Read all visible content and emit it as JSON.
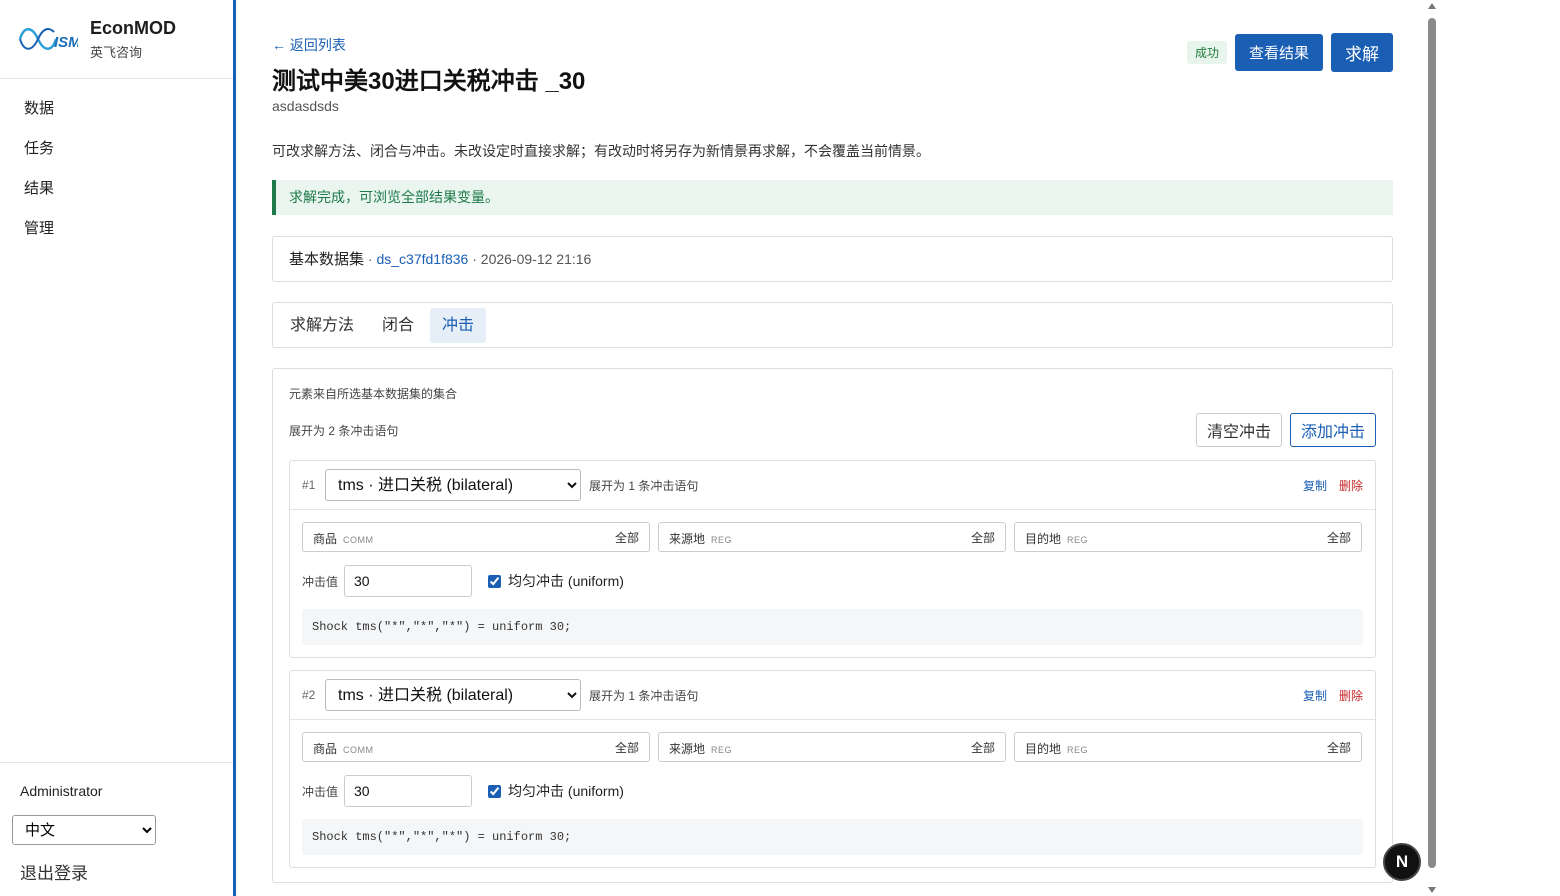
{
  "brand": {
    "name": "EconMOD",
    "sub": "英飞咨询",
    "logo_text": "ISM"
  },
  "sidebar": {
    "items": [
      {
        "label": "数据"
      },
      {
        "label": "任务"
      },
      {
        "label": "结果"
      },
      {
        "label": "管理"
      }
    ],
    "user": "Administrator",
    "language": "中文",
    "logout": "退出登录"
  },
  "header": {
    "back": "← 返回列表",
    "title": "测试中美30进口关税冲击 _30",
    "subtitle": "asdasdsds",
    "status_badge": "成功",
    "view_results": "查看结果",
    "solve": "求解"
  },
  "description": "可改求解方法、闭合与冲击。未改设定时直接求解；有改动时将另存为新情景再求解，不会覆盖当前情景。",
  "alert": "求解完成，可浏览全部结果变量。",
  "dataset": {
    "label": "基本数据集",
    "sep1": " · ",
    "id": "ds_c37fd1f836",
    "sep2": " · ",
    "time": "2026-09-12 21:16"
  },
  "tabs": [
    {
      "label": "求解方法"
    },
    {
      "label": "闭合"
    },
    {
      "label": "冲击"
    }
  ],
  "shocks_panel": {
    "hint_elements": "元素来自所选基本数据集的集合",
    "hint_expand": "展开为 2 条冲击语句",
    "clear": "清空冲击",
    "add": "添加冲击"
  },
  "shocks": [
    {
      "num": "#1",
      "variable": "tms · 进口关税 (bilateral)",
      "expand": "展开为 1 条冲击语句",
      "copy": "复制",
      "delete": "删除",
      "dims": [
        {
          "label": "商品",
          "tag": "COMM",
          "value": "全部"
        },
        {
          "label": "来源地",
          "tag": "REG",
          "value": "全部"
        },
        {
          "label": "目的地",
          "tag": "REG",
          "value": "全部"
        }
      ],
      "value_label": "冲击值",
      "value": "30",
      "uniform_label": "均匀冲击 (uniform)",
      "uniform": true,
      "code": "Shock tms(\"*\",\"*\",\"*\") = uniform 30;"
    },
    {
      "num": "#2",
      "variable": "tms · 进口关税 (bilateral)",
      "expand": "展开为 1 条冲击语句",
      "copy": "复制",
      "delete": "删除",
      "dims": [
        {
          "label": "商品",
          "tag": "COMM",
          "value": "全部"
        },
        {
          "label": "来源地",
          "tag": "REG",
          "value": "全部"
        },
        {
          "label": "目的地",
          "tag": "REG",
          "value": "全部"
        }
      ],
      "value_label": "冲击值",
      "value": "30",
      "uniform_label": "均匀冲击 (uniform)",
      "uniform": true,
      "code": "Shock tms(\"*\",\"*\",\"*\") = uniform 30;"
    }
  ],
  "dev_badge": "N",
  "colors": {
    "accent": "#1a5fb4",
    "success_bg": "#e9f5ee",
    "success": "#1e7a4a",
    "danger": "#c62828"
  }
}
